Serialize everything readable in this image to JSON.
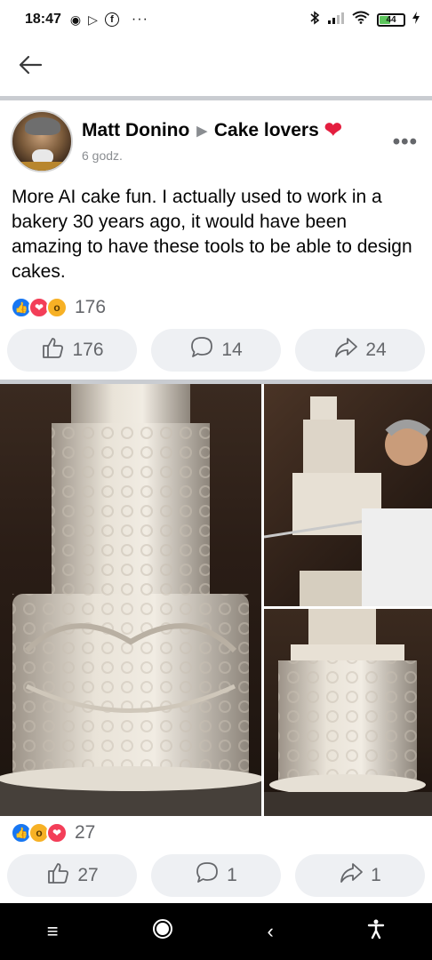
{
  "status_bar": {
    "time": "18:47",
    "battery_percent": "44",
    "battery_level": 0.44,
    "left_icons": [
      "chat-bubble-icon",
      "play-store-icon",
      "facebook-icon",
      "more-dots-icon"
    ],
    "right_icons": [
      "bluetooth-icon",
      "signal-icon",
      "wifi-icon",
      "battery-icon",
      "charging-icon"
    ]
  },
  "nav": {
    "back_icon": "back-arrow-icon"
  },
  "posts": [
    {
      "author": "Matt Donino",
      "group": "Cake lovers",
      "time": "6 godz.",
      "text": "More AI cake fun. I actually used to work in a bakery 30 years ago, it would have been amazing to have these tools to be able to design cakes.",
      "reaction_count": "176",
      "actions": {
        "like": "176",
        "comment": "14",
        "share": "24"
      }
    },
    {
      "reaction_count": "27",
      "actions": {
        "like": "27",
        "comment": "1",
        "share": "1"
      }
    }
  ],
  "colors": {
    "accent": "#1877f2",
    "love": "#f33e58",
    "wow": "#f7b125",
    "heart": "#e41e3f",
    "muted_text": "#65676b",
    "button_bg": "#eef0f3"
  },
  "system_nav": [
    "menu-icon",
    "home-icon",
    "back-icon",
    "accessibility-icon"
  ]
}
